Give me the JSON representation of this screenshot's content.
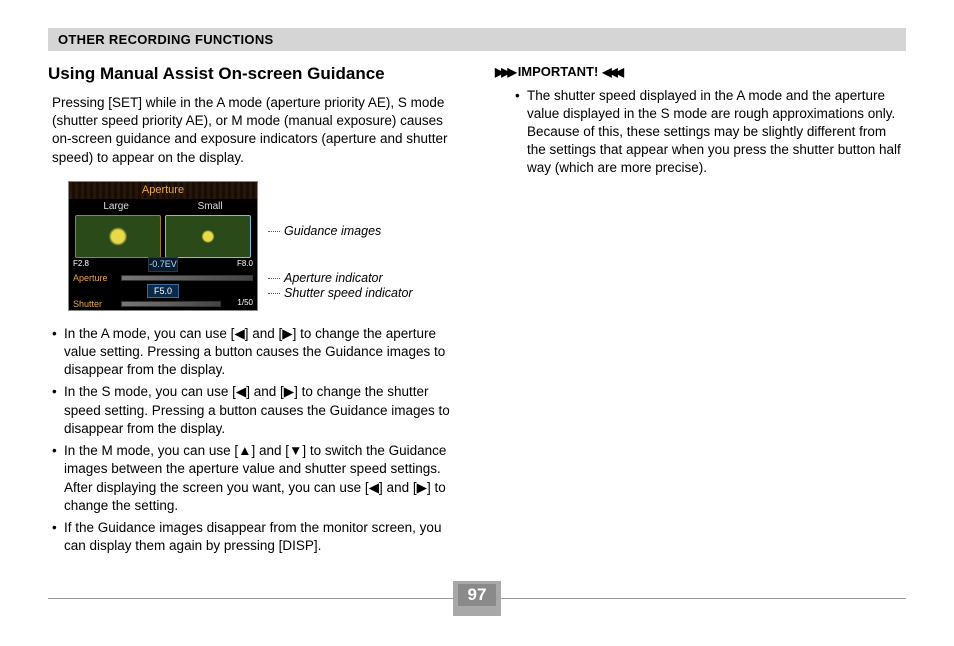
{
  "header": "OTHER RECORDING FUNCTIONS",
  "left": {
    "title": "Using Manual Assist On-screen Guidance",
    "intro": "Pressing [SET] while in the A mode (aperture priority AE), S mode (shutter speed priority AE), or M mode (manual exposure) causes on-screen guidance and exposure indicators (aperture and shutter speed) to appear on the display.",
    "callouts": {
      "guidance": "Guidance images",
      "aperture": "Aperture indicator",
      "shutter": "Shutter speed indicator"
    },
    "bullets": [
      "In the A mode, you can use [◀] and [▶] to change the aperture value setting. Pressing a button causes the Guidance images to disappear from the display.",
      "In the S mode, you can use [◀] and [▶] to change the shutter speed setting. Pressing a button causes the Guidance images to disappear from the display.",
      "In the M mode, you can use [▲] and [▼] to switch the Guidance images between the aperture value and shutter speed settings. After displaying the screen you want, you can use [◀] and [▶] to change the setting.",
      "If the Guidance images disappear from the monitor screen, you can display them again by pressing [DISP]."
    ]
  },
  "lcd": {
    "title": "Aperture",
    "large": "Large",
    "small": "Small",
    "ev_disp": "-0.7EV",
    "aperture_label": "Aperture",
    "aperture_value": "F5.0",
    "shutter_label": "Shutter",
    "shutter_value": "1/50",
    "left_f": "F2.8",
    "right_f": "F8.0"
  },
  "right": {
    "important": "IMPORTANT!",
    "items": [
      "The shutter speed displayed in the A mode and the aperture value displayed in the S mode are rough approximations only. Because of this, these settings may be slightly different from the settings that appear when you press the shutter button half way (which are more precise)."
    ]
  },
  "page": "97"
}
